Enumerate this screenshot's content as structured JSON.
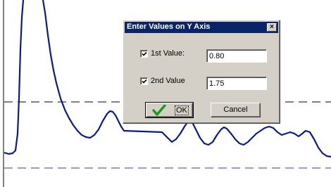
{
  "dialog": {
    "title": "Enter Values on Y Axis",
    "close_glyph": "×",
    "first_value": {
      "label": "1st Value:",
      "checked": true,
      "value": "0.80"
    },
    "second_value": {
      "label": "2nd Value",
      "checked": true,
      "value": "1.75"
    },
    "ok_label": "OK",
    "ok_icon": "green-checkmark-icon",
    "cancel_label": "Cancel"
  },
  "colors": {
    "curve": "#0a1a8c",
    "dashed_line_upper": "#000000",
    "dashed_line_lower": "#3a3a8c",
    "title_bar": "#0a246a",
    "dialog_face": "#d4d0c8",
    "ok_check": "#1a9a1a"
  }
}
